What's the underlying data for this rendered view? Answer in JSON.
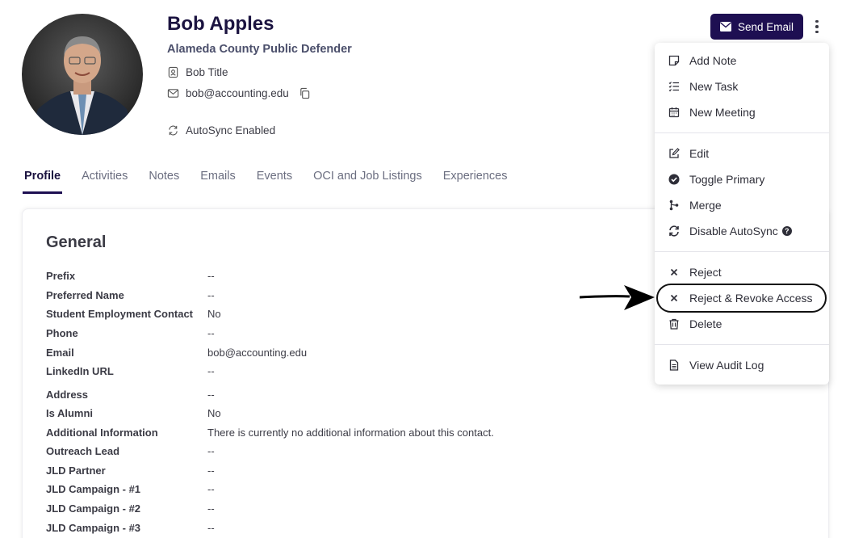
{
  "contact": {
    "name": "Bob Apples",
    "organization": "Alameda County Public Defender",
    "title": "Bob Title",
    "email": "bob@accounting.edu",
    "sync_status": "AutoSync Enabled"
  },
  "actions": {
    "send_email": "Send Email"
  },
  "tabs": [
    {
      "label": "Profile",
      "active": true
    },
    {
      "label": "Activities"
    },
    {
      "label": "Notes"
    },
    {
      "label": "Emails"
    },
    {
      "label": "Events"
    },
    {
      "label": "OCI and Job Listings"
    },
    {
      "label": "Experiences"
    }
  ],
  "general": {
    "heading": "General",
    "fields": [
      {
        "label": "Prefix",
        "value": "--"
      },
      {
        "label": "Preferred Name",
        "value": "--"
      },
      {
        "label": "Student Employment Contact",
        "value": "No"
      },
      {
        "label": "Phone",
        "value": "--"
      },
      {
        "label": "Email",
        "value": "bob@accounting.edu"
      },
      {
        "label": "LinkedIn URL",
        "value": "--"
      },
      {
        "label": "Address",
        "value": "--"
      },
      {
        "label": "Is Alumni",
        "value": "No"
      },
      {
        "label": "Additional Information",
        "value": "There is currently no additional information about this contact."
      },
      {
        "label": "Outreach Lead",
        "value": "--"
      },
      {
        "label": "JLD Partner",
        "value": "--"
      },
      {
        "label": "JLD Campaign - #1",
        "value": "--"
      },
      {
        "label": "JLD Campaign - #2",
        "value": "--"
      },
      {
        "label": "JLD Campaign - #3",
        "value": "--"
      }
    ]
  },
  "menu": {
    "items": [
      {
        "label": "Add Note",
        "icon": "note-icon"
      },
      {
        "label": "New Task",
        "icon": "task-list-icon"
      },
      {
        "label": "New Meeting",
        "icon": "calendar-icon"
      },
      {
        "label": "Edit",
        "icon": "edit-icon"
      },
      {
        "label": "Toggle Primary",
        "icon": "check-circle-icon"
      },
      {
        "label": "Merge",
        "icon": "merge-icon"
      },
      {
        "label": "Disable AutoSync",
        "icon": "sync-icon",
        "help": "?"
      },
      {
        "label": "Reject",
        "icon": "x-icon"
      },
      {
        "label": "Reject & Revoke Access",
        "icon": "x-icon",
        "highlighted": true
      },
      {
        "label": "Delete",
        "icon": "trash-icon"
      },
      {
        "label": "View Audit Log",
        "icon": "document-icon"
      }
    ]
  },
  "colors": {
    "primary": "#1e0f52",
    "name_text": "#1b1340",
    "org_text": "#4b4f6b"
  }
}
